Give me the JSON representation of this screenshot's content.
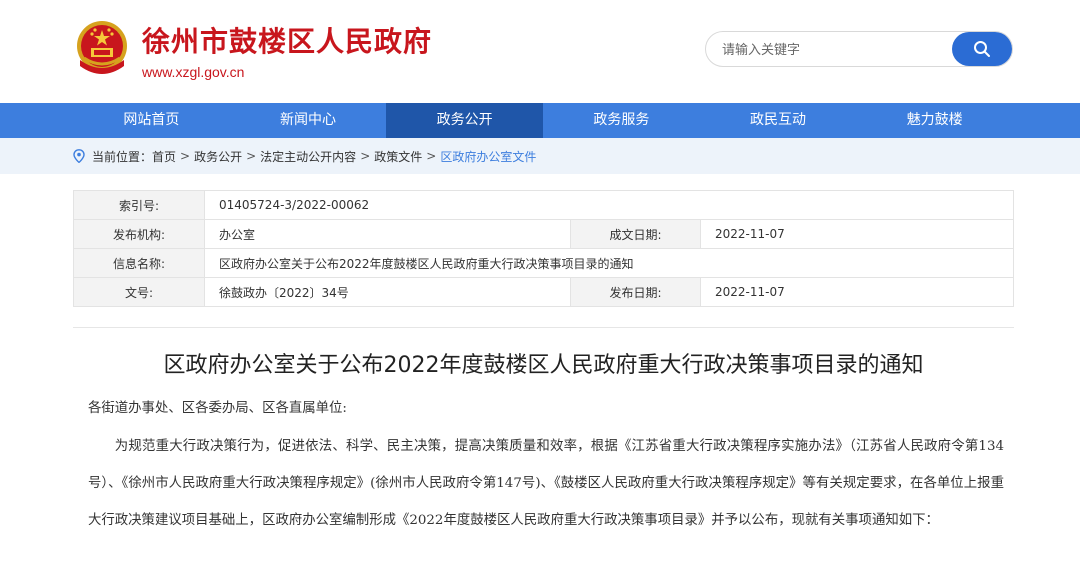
{
  "header": {
    "site_title": "徐州市鼓楼区人民政府",
    "site_url": "www.xzgl.gov.cn",
    "search_placeholder": "请输入关键字",
    "brand_color": "#c8161d",
    "search_icon": "search-icon"
  },
  "nav": {
    "items": [
      {
        "label": "网站首页"
      },
      {
        "label": "新闻中心"
      },
      {
        "label": "政务公开",
        "active": true
      },
      {
        "label": "政务服务"
      },
      {
        "label": "政民互动"
      },
      {
        "label": "魅力鼓楼"
      }
    ],
    "bg_color": "#3d7ede",
    "active_color": "#1f56a9"
  },
  "breadcrumb": {
    "prefix": "当前位置：",
    "items": [
      "首页",
      "政务公开",
      "法定主动公开内容",
      "政策文件",
      "区政府办公室文件"
    ],
    "separator": ">"
  },
  "info": {
    "index_label": "索引号:",
    "index_value": "01405724-3/2022-00062",
    "publisher_label": "发布机构:",
    "publisher_value": "办公室",
    "created_label": "成文日期:",
    "created_value": "2022-11-07",
    "name_label": "信息名称:",
    "name_value": "区政府办公室关于公布2022年度鼓楼区人民政府重大行政决策事项目录的通知",
    "docno_label": "文号:",
    "docno_value": "徐鼓政办〔2022〕34号",
    "published_label": "发布日期:",
    "published_value": "2022-11-07"
  },
  "article": {
    "title": "区政府办公室关于公布2022年度鼓楼区人民政府重大行政决策事项目录的通知",
    "salutation": "各街道办事处、区各委办局、区各直属单位:",
    "paragraph": "为规范重大行政决策行为，促进依法、科学、民主决策，提高决策质量和效率，根据《江苏省重大行政决策程序实施办法》（江苏省人民政府令第134号）、《徐州市人民政府重大行政决策程序规定》(徐州市人民政府令第147号)、《鼓楼区人民政府重大行政决策程序规定》等有关规定要求，在各单位上报重大行政决策建议项目基础上，区政府办公室编制形成《2022年度鼓楼区人民政府重大行政决策事项目录》并予以公布，现就有关事项通知如下："
  }
}
